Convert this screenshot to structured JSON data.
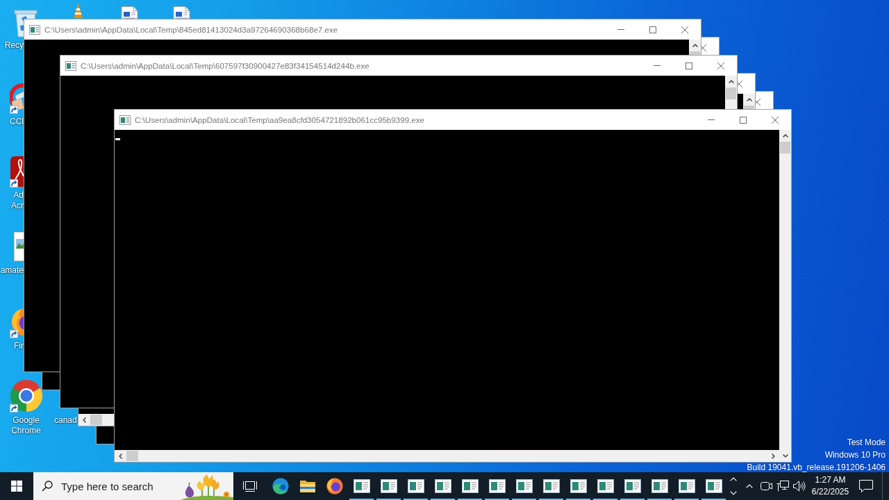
{
  "desktop": {
    "icons": [
      {
        "kind": "bin",
        "label": [
          "Recy"
        ],
        "shortcut": false
      },
      {
        "kind": "cleaner",
        "label": [
          "CCl"
        ],
        "shortcut": true
      },
      {
        "kind": "pdf",
        "label": [
          "Ad",
          "Acr"
        ],
        "shortcut": true
      },
      {
        "kind": "picture",
        "label": [
          "amate"
        ],
        "shortcut": false
      },
      {
        "kind": "firefox",
        "label": [
          "Fir"
        ],
        "shortcut": true
      },
      {
        "kind": "chrome",
        "label": [
          "Google",
          "Chrome"
        ],
        "shortcut": true
      },
      {
        "kind": "cone"
      },
      {
        "label": [
          "canad"
        ]
      },
      {
        "kind": "document"
      },
      {
        "kind": "document"
      }
    ],
    "system_text": [
      "Test Mode",
      "Windows 10 Pro",
      "Build 19041.vb_release.191206-1406"
    ]
  },
  "windows": [
    {
      "title": "C:\\Users\\admin\\AppData\\Local\\Temp\\845ed81413024d3a97264690368b68e7.exe",
      "controls": [
        {
          "kind": "minimize"
        },
        {
          "kind": "maximize"
        },
        {
          "kind": "close"
        }
      ],
      "vertical_scrollbar": {
        "arrows": [
          {
            "kind": "up"
          }
        ]
      },
      "cursor": false
    },
    {
      "controls": [
        {
          "kind": "close"
        }
      ]
    },
    {
      "title": "C:\\Users\\admin\\AppData\\Local\\Temp\\607597f30900427e83f34154514d244b.exe",
      "controls": [
        {
          "kind": "minimize"
        },
        {
          "kind": "maximize"
        },
        {
          "kind": "close"
        }
      ],
      "vertical_scrollbar": {
        "arrows": [
          {
            "kind": "up"
          }
        ]
      },
      "cursor": false
    },
    {
      "controls": [
        {
          "kind": "close"
        }
      ],
      "vertical_scrollbar": {
        "arrows": [
          {
            "kind": "up"
          }
        ]
      },
      "horizontal_scrollbar": {
        "arrows": [
          {
            "kind": "left"
          }
        ]
      }
    },
    {
      "controls": [
        {
          "kind": "close"
        }
      ]
    },
    {
      "title": "C:\\Users\\admin\\AppData\\Local\\Temp\\aa9ea8cfd3054721892b061cc95b9399.exe",
      "controls": [
        {
          "kind": "minimize"
        },
        {
          "kind": "maximize"
        },
        {
          "kind": "close"
        }
      ],
      "vertical_scrollbar": {
        "arrows": [
          {
            "kind": "up"
          },
          {
            "kind": "down"
          }
        ]
      },
      "horizontal_scrollbar": {
        "arrows": [
          {
            "kind": "left"
          },
          {
            "kind": "right"
          }
        ]
      },
      "cursor": true
    }
  ],
  "taskbar": {
    "search": {
      "placeholder": "Type here to search"
    },
    "apps": [
      {
        "kind": "edge",
        "running": false
      },
      {
        "kind": "folder",
        "running": false
      },
      {
        "kind": "firefox",
        "running": false
      },
      {
        "kind": "console",
        "running": true
      },
      {
        "kind": "console",
        "running": true
      },
      {
        "kind": "console",
        "running": true
      },
      {
        "kind": "console",
        "running": true
      },
      {
        "kind": "console",
        "running": true
      },
      {
        "kind": "console",
        "running": true
      },
      {
        "kind": "console",
        "running": true
      },
      {
        "kind": "console",
        "running": true
      },
      {
        "kind": "console",
        "running": true
      },
      {
        "kind": "console",
        "running": true
      },
      {
        "kind": "console",
        "running": true
      },
      {
        "kind": "console",
        "running": true
      },
      {
        "kind": "console",
        "running": true
      },
      {
        "kind": "console",
        "running": true
      }
    ],
    "clock": {
      "time": "1:27 AM",
      "date": "6/22/2025"
    }
  }
}
